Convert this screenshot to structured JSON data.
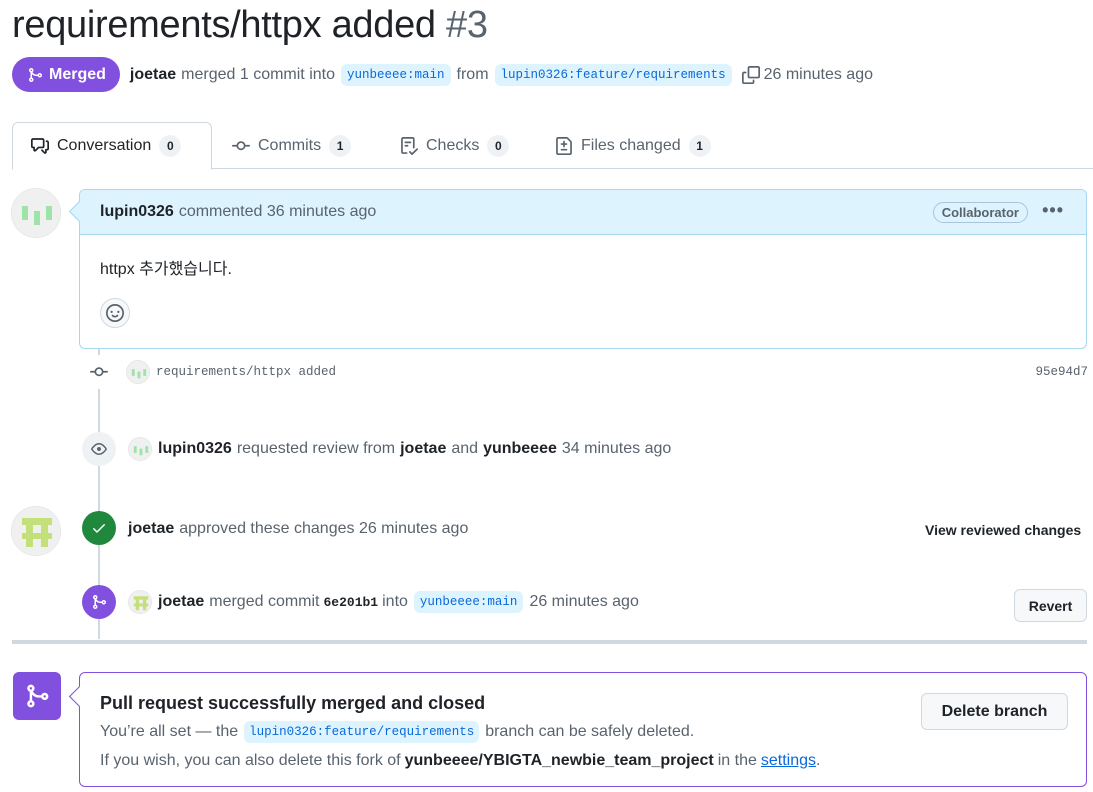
{
  "pr": {
    "title": "requirements/httpx added",
    "number": "#3",
    "status": "Merged",
    "merger": "joetae",
    "merged_text": "merged 1 commit into",
    "base_branch": "yunbeeee:main",
    "from_text": "from",
    "head_branch": "lupin0326:feature/requirements",
    "time": "26 minutes ago"
  },
  "tabs": [
    {
      "label": "Conversation",
      "count": "0",
      "icon": "comment-discussion-icon"
    },
    {
      "label": "Commits",
      "count": "1",
      "icon": "git-commit-icon"
    },
    {
      "label": "Checks",
      "count": "0",
      "icon": "checklist-icon"
    },
    {
      "label": "Files changed",
      "count": "1",
      "icon": "file-diff-icon"
    }
  ],
  "comment": {
    "author": "lupin0326",
    "action": "commented 36 minutes ago",
    "role": "Collaborator",
    "more": "•••",
    "body": "httpx 추가했습니다."
  },
  "timeline": {
    "commit": {
      "message": "requirements/httpx added",
      "sha": "95e94d7"
    },
    "review_request": {
      "author": "lupin0326",
      "text1": "requested review from",
      "reviewer1": "joetae",
      "and": "and",
      "reviewer2": "yunbeeee",
      "time": "34 minutes ago"
    },
    "approval": {
      "author": "joetae",
      "text": "approved these changes 26 minutes ago",
      "link": "View reviewed changes"
    },
    "merge": {
      "author": "joetae",
      "text1": "merged commit",
      "sha": "6e201b1",
      "text2": "into",
      "branch": "yunbeeee:main",
      "time": "26 minutes ago",
      "revert_label": "Revert"
    }
  },
  "merge_box": {
    "title": "Pull request successfully merged and closed",
    "line1_pre": "You’re all set — the",
    "line1_branch": "lupin0326:feature/requirements",
    "line1_post": "branch can be safely deleted.",
    "line2_pre": "If you wish, you can also delete this fork of",
    "line2_repo": "yunbeeee/YBIGTA_newbie_team_project",
    "line2_mid": "in the",
    "line2_link": "settings",
    "line2_end": ".",
    "delete_label": "Delete branch"
  },
  "colors": {
    "merged_purple": "#8250df",
    "approved_green": "#1f883d",
    "link_blue": "#0969da",
    "branch_bg": "#ddf4ff"
  }
}
